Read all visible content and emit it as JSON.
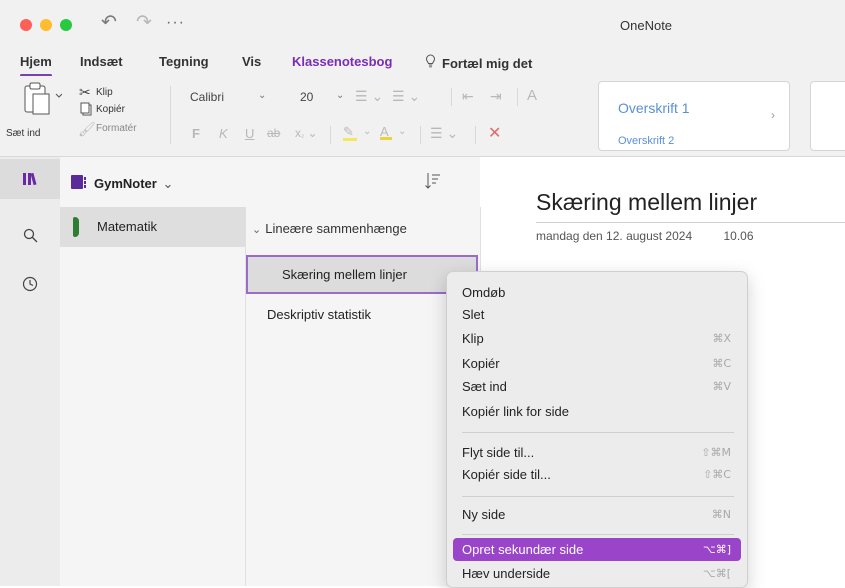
{
  "window": {
    "title": "OneNote"
  },
  "tabs": [
    "Hjem",
    "Indsæt",
    "Tegning",
    "Vis",
    "Klassenotesbog",
    "Fortæl mig det"
  ],
  "toolbar": {
    "paste_label": "Sæt ind",
    "cut_label": "Klip",
    "copy_label": "Kopiér",
    "format_label": "Formatér",
    "font": "Calibri",
    "font_size": "20",
    "bold": "F",
    "italic": "K",
    "underline": "U",
    "strike": "ab",
    "subscript": "x",
    "styles": [
      "Overskrift 1",
      "Overskrift 2"
    ]
  },
  "notebook": {
    "name": "GymNoter",
    "chevron": "⌄"
  },
  "sections": [
    {
      "label": "Matematik",
      "color": "#2f7d32"
    }
  ],
  "pages": {
    "group": "Lineære sammenhænge",
    "items": [
      "Skæring mellem linjer",
      "Deskriptiv statistik"
    ]
  },
  "page": {
    "title": "Skæring mellem linjer",
    "date": "mandag den 12. august 2024",
    "time": "10.06"
  },
  "context_menu": {
    "group1": [
      {
        "label": "Omdøb",
        "shortcut": ""
      },
      {
        "label": "Slet",
        "shortcut": ""
      },
      {
        "label": "Klip",
        "shortcut": "⌘X"
      },
      {
        "label": "Kopiér",
        "shortcut": "⌘C"
      },
      {
        "label": "Sæt ind",
        "shortcut": "⌘V"
      },
      {
        "label": "Kopiér link for side",
        "shortcut": ""
      }
    ],
    "group2": [
      {
        "label": "Flyt side til...",
        "shortcut": "⇧⌘M"
      },
      {
        "label": "Kopiér side til...",
        "shortcut": "⇧⌘C"
      }
    ],
    "group3": [
      {
        "label": "Ny side",
        "shortcut": "⌘N"
      }
    ],
    "group4": [
      {
        "label": "Opret sekundær side",
        "shortcut": "⌥⌘]"
      },
      {
        "label": "Hæv underside",
        "shortcut": "⌥⌘["
      }
    ]
  },
  "colors": {
    "accent": "#7a2cb8",
    "highlight": "#9a45c9"
  },
  "icons": [
    "undo-icon",
    "redo-icon",
    "more-icon",
    "lightbulb-icon",
    "notebooks-icon",
    "search-icon",
    "recent-icon",
    "sort-icon"
  ]
}
